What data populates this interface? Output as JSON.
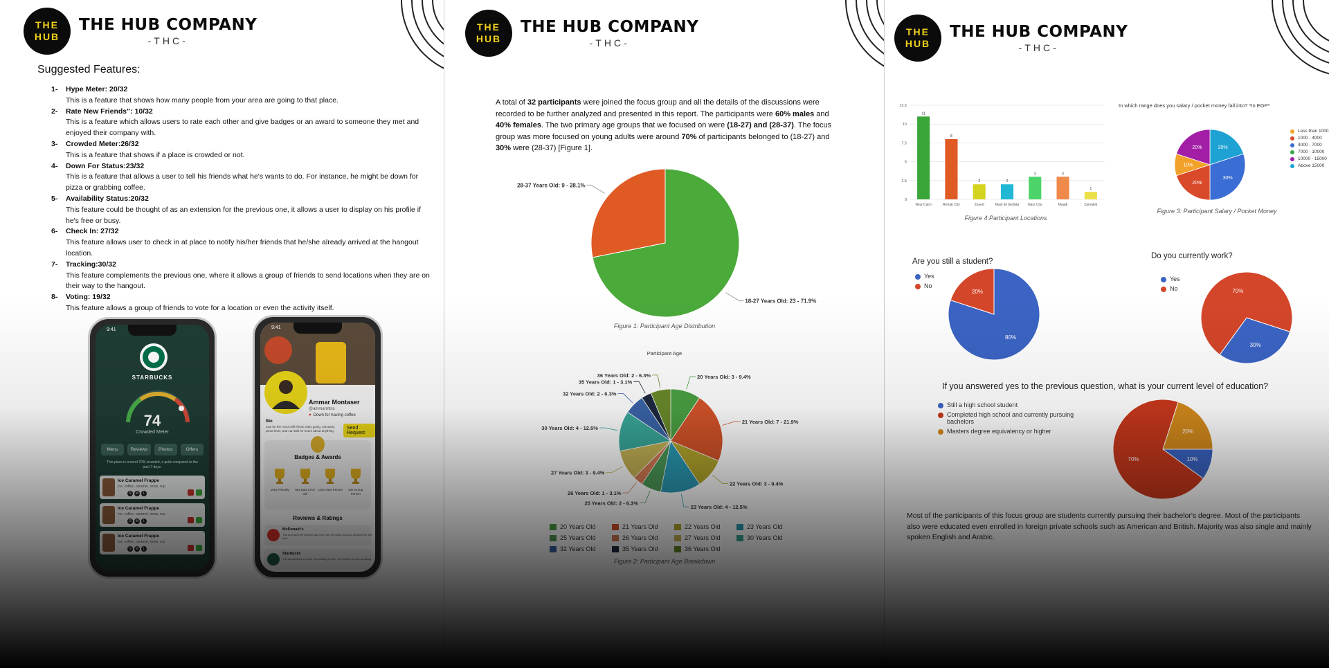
{
  "brand": {
    "circle_line1": "THE",
    "circle_line2": "HUB",
    "name": "THE HUB COMPANY",
    "abbr": "-THC-",
    "color": "#f2d21b"
  },
  "page1": {
    "title": "Suggested Features:",
    "features": [
      {
        "num": "1-",
        "head": "Hype Meter: 20/32",
        "desc": "This is a feature that shows how many people from your area are going to that place."
      },
      {
        "num": "2-",
        "head": "Rate New Friends\": 10/32",
        "desc": "This is a feature which allows users to rate each other and give badges or an award to someone they met and enjoyed their company with."
      },
      {
        "num": "3-",
        "head": "Crowded Meter:26/32",
        "desc": "This is a feature that shows if a place is crowded or not."
      },
      {
        "num": "4-",
        "head": "Down For Status:23/32",
        "desc": "This is a feature that allows a user to tell his friends what he's wants to do. For instance, he might be down for pizza or grabbing coffee."
      },
      {
        "num": "5-",
        "head": "Availability Status:20/32",
        "desc": "This feature could be thought of as an extension for the previous one, it allows a user to display on his profile if he's free or busy."
      },
      {
        "num": "6-",
        "head": "Check In: 27/32",
        "desc": "This feature allows user to check in at place to notify his/her friends that he/she already arrived at the hangout location."
      },
      {
        "num": "7-",
        "head": "Tracking:30/32",
        "desc": "This feature complements the previous one, where it allows a group of friends to send locations when they are on their way to the hangout."
      },
      {
        "num": "8-",
        "head": "Voting: 19/32",
        "desc": "This feature allows a group of friends to vote for a location or even the activity itself."
      }
    ],
    "phone1": {
      "time": "9:41",
      "brand": "STARBUCKS",
      "meter_value": "74",
      "meter_label": "Crowded Meter",
      "tabs": [
        "Menu",
        "Reviews",
        "Photos",
        "Offers"
      ],
      "note": "This place is around 70% crowded, a quite compared to the past 7 days.",
      "items": [
        "Ice Caramel Frappe",
        "Ice Caramel Frappe",
        "Ice Caramel Frappe"
      ],
      "item_sub": "Ice, coffee, caramel, straw, cup",
      "sizes": [
        "S",
        "M",
        "L"
      ]
    },
    "phone2": {
      "time": "9:41",
      "name": "Ammar Montaser",
      "handle": "@ammarmtns",
      "status": "Down for having coffee",
      "bio_label": "Bio",
      "bio": "Can be the most chill friend, easy going, sarcastic, pizza lover, and can talk for hours about anything.",
      "send_request": "Send Request",
      "badges_title": "Badges & Awards",
      "badges": [
        "100x Friendly",
        "50x Eats to be still",
        "120x New Person",
        "20x Group Person"
      ],
      "reviews_title": "Reviews & Ratings",
      "reviews": [
        {
          "place": "McDonald's",
          "text": "The food and the service was nice, but the place was too crowded for the time."
        },
        {
          "place": "Starbucks",
          "text": "The atmosphere is good, the seating is nice, the people too are amazing."
        }
      ]
    }
  },
  "page2": {
    "paragraph": [
      {
        "t": "A total of ",
        "b": false
      },
      {
        "t": "32 participants",
        "b": true
      },
      {
        "t": " were joined the focus group and all the details of the discussions were recorded to be further analyzed and presented in this report. The participants were ",
        "b": false
      },
      {
        "t": "60% males",
        "b": true
      },
      {
        "t": " and ",
        "b": false
      },
      {
        "t": "40% females",
        "b": true
      },
      {
        "t": ". The two primary age groups that we focused on were ",
        "b": false
      },
      {
        "t": "(18-27) and (28-37)",
        "b": true
      },
      {
        "t": ". The focus group was more focused on young adults were around ",
        "b": false
      },
      {
        "t": "70%",
        "b": true
      },
      {
        "t": " of participants belonged to (18-27) and ",
        "b": false
      },
      {
        "t": "30%",
        "b": true
      },
      {
        "t": " were (28-37) [Figure 1].",
        "b": false
      }
    ],
    "fig1_caption": "Figure 1: Participant Age Distribution",
    "fig2_title": "Participant Age",
    "fig2_caption": "Figure 2: Participant Age Breakdown"
  },
  "page3": {
    "fig4_caption": "Figure 4:Participant Locations",
    "fig3_title": "In which range does you salary / pocket money fall into? *In EGP*",
    "fig3_caption": "Figure 3: Participant Salary / Pocket Money",
    "student_q": "Are you still a student?",
    "work_q": "Do you currently work?",
    "edu_q": "If you answered yes to the previous question, what is your current level of education?",
    "yes": "Yes",
    "no": "No",
    "edu_legend": [
      "Still a high school student",
      "Completed high school and currently pursuing bachelors",
      "Masters degree equivalency or higher"
    ],
    "conclusion": "Most of the participants of this focus group are students currently pursuing their bachelor's degree. Most of the participants also were educated even enrolled in foreign private schools such as American and British. Majority was also single and mainly spoken English and Arabic."
  },
  "chart_data": [
    {
      "id": "fig1",
      "type": "pie",
      "slices": [
        {
          "label": "18-27 Years Old: 23 - 71.9%",
          "value": 23,
          "color": "#4aaa3a"
        },
        {
          "label": "28-37 Years Old: 9 - 28.1%",
          "value": 9,
          "color": "#e05a24"
        }
      ]
    },
    {
      "id": "fig2",
      "type": "pie",
      "title": "Participant Age",
      "slices": [
        {
          "label": "20 Years Old: 3 - 9.4%",
          "legend": "20 Years Old",
          "value": 3,
          "color": "#4aa043"
        },
        {
          "label": "21 Years Old: 7 - 21.9%",
          "legend": "21 Years Old",
          "value": 7,
          "color": "#d4542a"
        },
        {
          "label": "22 Years Old: 3 - 9.4%",
          "legend": "22 Years Old",
          "value": 3,
          "color": "#b4a62c"
        },
        {
          "label": "23 Years Old: 4 - 12.5%",
          "legend": "23 Years Old",
          "value": 4,
          "color": "#2a9ab4"
        },
        {
          "label": "25 Years Old: 2 - 6.3%",
          "legend": "25 Years Old",
          "value": 2,
          "color": "#4c9a58"
        },
        {
          "label": "26 Years Old: 1 - 3.1%",
          "legend": "26 Years Old",
          "value": 1,
          "color": "#d47a54"
        },
        {
          "label": "27 Years Old: 3 - 9.4%",
          "legend": "27 Years Old",
          "value": 3,
          "color": "#c4b254"
        },
        {
          "label": "30 Years Old: 4 - 12.5%",
          "legend": "30 Years Old",
          "value": 4,
          "color": "#3aa89a"
        },
        {
          "label": "32 Years Old: 2 - 6.3%",
          "legend": "32 Years Old",
          "value": 2,
          "color": "#3a64a8"
        },
        {
          "label": "35 Years Old: 1 - 3.1%",
          "legend": "35 Years Old",
          "value": 1,
          "color": "#1e2a40"
        },
        {
          "label": "36 Years Old: 2 - 6.3%",
          "legend": "36 Years Old",
          "value": 2,
          "color": "#6a8a2a"
        }
      ]
    },
    {
      "id": "fig4",
      "type": "bar",
      "categories": [
        "New Cairo",
        "Rehab City",
        "Zayed",
        "Masr El Gedida",
        "Nasr City",
        "Maadi",
        "Zamalek"
      ],
      "values": [
        11,
        8,
        2,
        2,
        3,
        3,
        1
      ],
      "colors": [
        "#3aa63a",
        "#e05a24",
        "#d4d420",
        "#20b8d4",
        "#4cd46a",
        "#f08a4a",
        "#ece04a"
      ],
      "yticks": [
        "0",
        "2.5",
        "5",
        "7.5",
        "10",
        "12.5"
      ],
      "ylim": [
        0,
        12.5
      ]
    },
    {
      "id": "fig3",
      "type": "pie",
      "slices": [
        {
          "label": "20%",
          "legend": "Less than 1000",
          "value": 0,
          "color": "#f2a12a"
        },
        {
          "label": "20%",
          "legend": "1000 - 4000",
          "value": 20,
          "color": "#d94a2a"
        },
        {
          "label": "30%",
          "legend": "4000 - 7000",
          "value": 30,
          "color": "#3a6ed4"
        },
        {
          "label": "",
          "legend": "7000 - 10000",
          "value": 0,
          "color": "#3aa64a"
        },
        {
          "label": "20%",
          "legend": "10000 - 15000",
          "value": 20,
          "color": "#a21ea6"
        },
        {
          "label": "20%",
          "legend": "Above 15000",
          "value": 20,
          "color": "#1ea2d4"
        }
      ],
      "display": [
        {
          "value": 20,
          "color": "#1ea2d4",
          "label": "20%"
        },
        {
          "value": 30,
          "color": "#3a6ed4",
          "label": "30%"
        },
        {
          "value": 20,
          "color": "#d94a2a",
          "label": "20%"
        },
        {
          "value": 10,
          "color": "#f2a12a",
          "label": "10%"
        },
        {
          "value": 20,
          "color": "#a21ea6",
          "label": "20%"
        }
      ]
    },
    {
      "id": "student",
      "type": "pie",
      "slices": [
        {
          "legend": "Yes",
          "label": "80%",
          "value": 80,
          "color": "#3b64c4"
        },
        {
          "legend": "No",
          "label": "20%",
          "value": 20,
          "color": "#d4462a"
        }
      ]
    },
    {
      "id": "work",
      "type": "pie",
      "slices": [
        {
          "legend": "Yes",
          "label": "30%",
          "value": 30,
          "color": "#3b64c4"
        },
        {
          "legend": "No",
          "label": "70%",
          "value": 70,
          "color": "#d4462a"
        }
      ]
    },
    {
      "id": "edu",
      "type": "pie",
      "slices": [
        {
          "legend": "Still a high school student",
          "label": "10%",
          "value": 10,
          "color": "#3b64c4"
        },
        {
          "legend": "Completed high school and currently pursuing bachelors",
          "label": "70%",
          "value": 70,
          "color": "#c8381c"
        },
        {
          "legend": "Masters degree equivalency or higher",
          "label": "20%",
          "value": 20,
          "color": "#d48a1c"
        }
      ]
    }
  ]
}
